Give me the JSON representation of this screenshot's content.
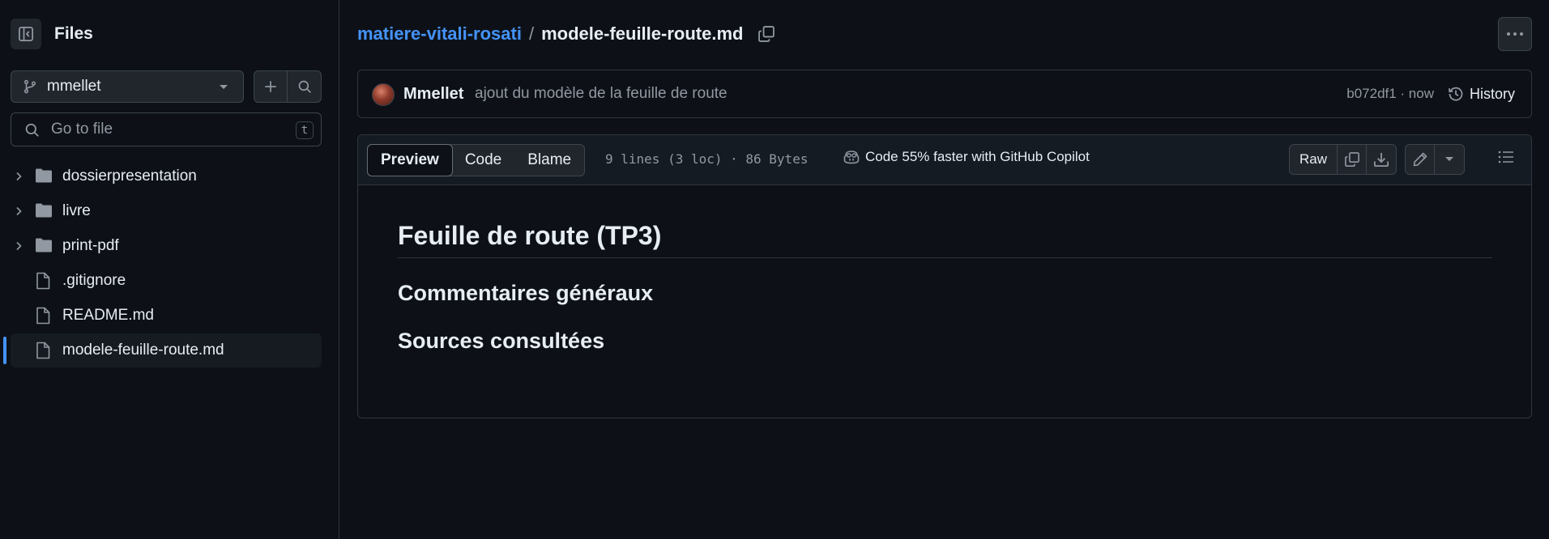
{
  "sidebar": {
    "title": "Files",
    "branch": "mmellet",
    "go_to_file_placeholder": "Go to file",
    "go_to_file_shortcut": "t",
    "tree": [
      {
        "name": "dossierpresentation",
        "type": "folder",
        "icon": "folder-icon"
      },
      {
        "name": "livre",
        "type": "folder",
        "icon": "folder-icon"
      },
      {
        "name": "print-pdf",
        "type": "folder",
        "icon": "folder-icon"
      },
      {
        "name": ".gitignore",
        "type": "file",
        "icon": "file-icon"
      },
      {
        "name": "README.md",
        "type": "file",
        "icon": "file-icon"
      },
      {
        "name": "modele-feuille-route.md",
        "type": "file",
        "icon": "file-icon",
        "selected": true
      }
    ]
  },
  "breadcrumb": {
    "repo": "matiere-vitali-rosati",
    "separator": "/",
    "file": "modele-feuille-route.md"
  },
  "commit": {
    "author": "Mmellet",
    "message": "ajout du modèle de la feuille de route",
    "meta": "b072df1 · now",
    "history_label": "History"
  },
  "file_header": {
    "tabs": [
      "Preview",
      "Code",
      "Blame"
    ],
    "active_tab": "Preview",
    "info": "9 lines (3 loc) · 86 Bytes",
    "copilot_text": "Code 55% faster with GitHub Copilot",
    "raw_label": "Raw"
  },
  "markdown": {
    "h1": "Feuille de route (TP3)",
    "h2_1": "Commentaires généraux",
    "h2_2": "Sources consultées"
  },
  "colors": {
    "background": "#0d1117",
    "link": "#4493f8",
    "muted": "#9198a1",
    "border": "#30363d"
  }
}
